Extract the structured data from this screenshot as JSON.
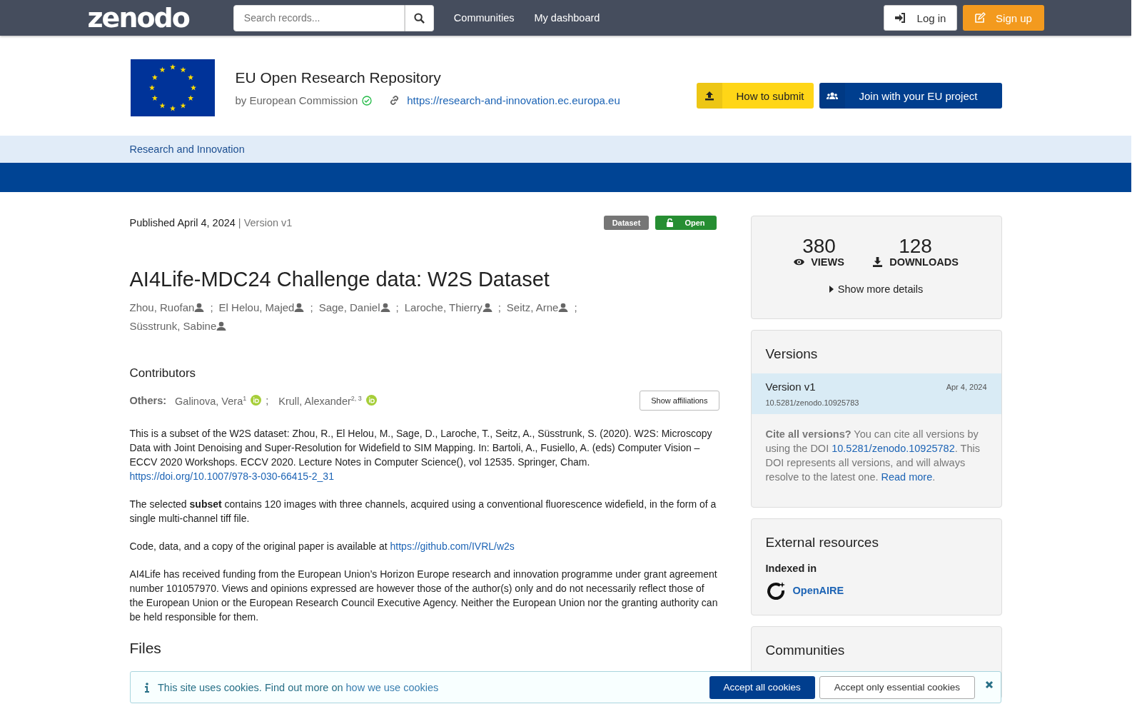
{
  "navbar": {
    "logo": "zenodo",
    "search": {
      "placeholder": "Search records..."
    },
    "links": [
      "Communities",
      "My dashboard"
    ],
    "login": "Log in",
    "signup": "Sign up"
  },
  "community": {
    "title": "EU Open Research Repository",
    "by": "by European Commission",
    "verified": true,
    "url": "https://research-and-innovation.ec.europa.eu",
    "buttons": [
      {
        "label": "How to submit",
        "kind": "submit"
      },
      {
        "label": "Join with your EU project",
        "kind": "join"
      }
    ],
    "subnav": [
      "Research and Innovation"
    ]
  },
  "record": {
    "published": "Published April 4, 2024",
    "version": "| Version v1",
    "badges": [
      {
        "label": "Dataset",
        "kind": "type"
      },
      {
        "label": "Open",
        "kind": "access"
      }
    ],
    "title": "AI4Life-MDC24 Challenge data: W2S Dataset",
    "creators": [
      {
        "name": "Zhou, Ruofan",
        "sep": ";"
      },
      {
        "name": "El Helou, Majed",
        "sep": ";"
      },
      {
        "name": "Sage, Daniel",
        "sep": ";"
      },
      {
        "name": "Laroche, Thierry",
        "sep": ";"
      },
      {
        "name": "Seitz, Arne",
        "sep": ";"
      },
      {
        "name": "Süsstrunk, Sabine"
      }
    ],
    "contributors_heading": "Contributors",
    "others_label": "Others:",
    "contributors": [
      {
        "name": "Galinova, Vera",
        "sup": "1",
        "sep": ";"
      },
      {
        "name": "Krull, Alexander",
        "sup": "2, 3"
      }
    ],
    "show_affiliations": "Show affiliations",
    "description": [
      {
        "text": "This is a subset of the W2S dataset: Zhou, R., El Helou, M., Sage, D., Laroche, T., Seitz, A., Süsstrunk, S. (2020). W2S: Microscopy Data with Joint Denoising and Super-Resolution for Widefield to SIM Mapping. In: Bartoli, A., Fusiello, A. (eds) Computer Vision – ECCV 2020 Workshops. ECCV 2020. Lecture Notes in Computer Science(), vol 12535. Springer, Cham. ",
        "link": "https://doi.org/10.1007/978-3-030-66415-2_31"
      },
      {
        "text": "The selected **subset** contains 120 images with three channels, acquired using a conventional fluorescence widefield, in the form of a single multi-channel tiff file."
      },
      {
        "text": "Code, data, and a copy of the original paper is available at  ",
        "link": "https://github.com/IVRL/w2s"
      },
      {
        "text": "AI4Life has received funding from the European Union’s Horizon Europe research and innovation programme under grant agreement number 101057970. Views and opinions expressed are however those of the author(s) only and do not necessarily reflect those of the European Union or the European Research Council Executive Agency. Neither the European Union nor the granting authority can be held responsible for them."
      }
    ],
    "files_heading": "Files"
  },
  "sidebar": {
    "stats": [
      {
        "value": "380",
        "label": "VIEWS",
        "kind": "views"
      },
      {
        "value": "128",
        "label": "DOWNLOADS",
        "kind": "downloads"
      }
    ],
    "more_details": "Show more details",
    "versions": {
      "heading": "Versions",
      "items": [
        {
          "title": "Version v1",
          "date": "Apr 4, 2024",
          "doi": "10.5281/zenodo.10925783",
          "selected": true
        }
      ],
      "cite_bold": "Cite all versions?",
      "cite_pre": " You can cite all versions by using the DOI ",
      "cite_doi": "10.5281/zenodo.10925782",
      "cite_post": ". This DOI represents all versions, and will always resolve to the latest one. ",
      "read_more": "Read more",
      "cite_end": "."
    },
    "external": {
      "heading": "External resources",
      "subheading": "Indexed in",
      "links": [
        "OpenAIRE"
      ]
    },
    "communities_heading": "Communities"
  },
  "cookies": {
    "text": "This site uses cookies. Find out more on ",
    "link": "how we use cookies",
    "accept_all": "Accept all cookies",
    "accept_essential": "Accept only essential cookies"
  }
}
